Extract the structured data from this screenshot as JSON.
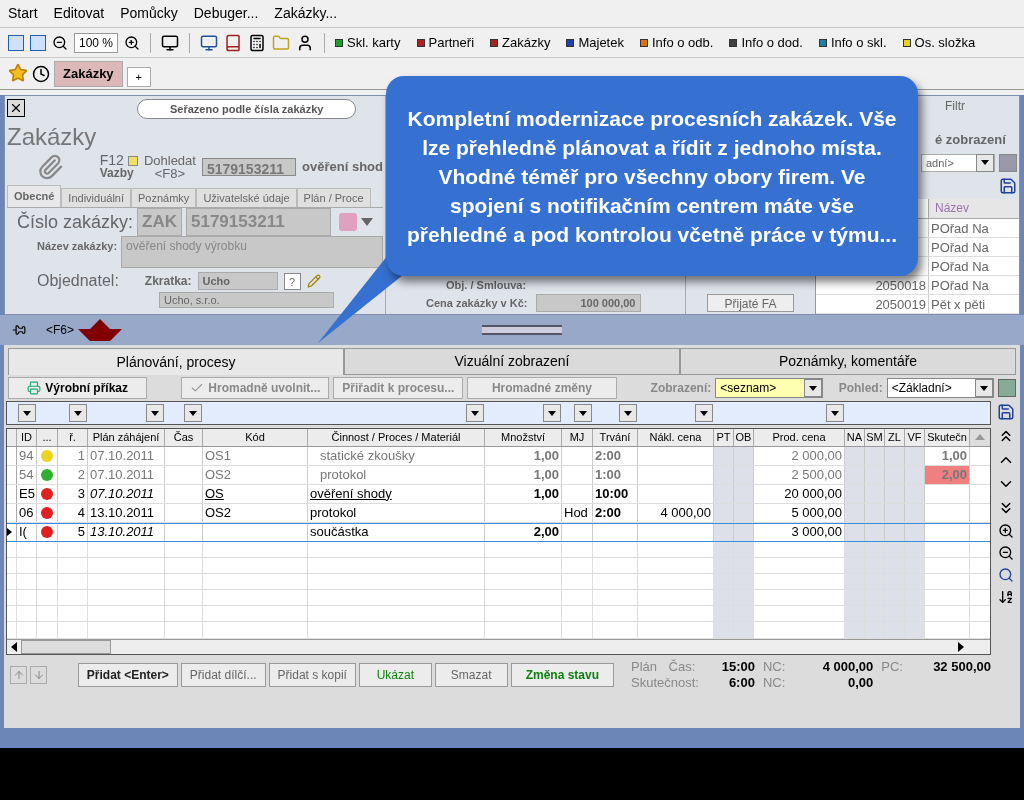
{
  "menu": [
    "Start",
    "Editovat",
    "Pomůcky",
    "Debuger...",
    "Zakázky..."
  ],
  "toolbar": {
    "zoom": "100 %",
    "shortcuts": [
      {
        "label": "Skl. karty",
        "color": "#1e9e2e"
      },
      {
        "label": "Partneři",
        "color": "#b02020"
      },
      {
        "label": "Zakázky",
        "color": "#b02020"
      },
      {
        "label": "Majetek",
        "color": "#2040c0"
      },
      {
        "label": "Info o odb.",
        "color": "#e07010"
      },
      {
        "label": "Info o dod.",
        "color": "#404040"
      },
      {
        "label": "Info o skl.",
        "color": "#2080a0"
      },
      {
        "label": "Os. složka",
        "color": "#e8d020"
      }
    ]
  },
  "doc_tabs": [
    {
      "label": "Zakázky",
      "selected": true
    }
  ],
  "new_tab": "+",
  "form": {
    "sort_hint": "Seřazeno podle čísla zakázky",
    "title": "Zakázky",
    "f12": "F12",
    "vazby": "Vazby",
    "search_label": "Dohledat",
    "search_key": "<F8>",
    "search_value": "5179153211",
    "search_result": "ověření shod",
    "tabs": [
      {
        "label": "Obecné",
        "selected": true
      },
      {
        "label": "Individuální",
        "selected": false
      },
      {
        "label": "Poznámky",
        "selected": false
      },
      {
        "label": "Uživatelské údaje",
        "selected": false
      },
      {
        "label": "Plán / Proce",
        "selected": false
      }
    ],
    "number_label": "Číslo zakázky:",
    "prefix": "ZAK",
    "number": "5179153211",
    "name_label": "Název zakázky:",
    "name": "ověření shody výrobku",
    "customer_label": "Objednatel:",
    "short_label": "Zkratka:",
    "short": "Ucho",
    "help": "?",
    "customer": "Ucho, s.r.o.",
    "contract_label": "Obj. / Smlouva:",
    "price_label": "Cena zakázky v Kč:",
    "price": "100 000,00",
    "invoice_button": "Přijaté FA",
    "filter": "Filtr",
    "view_partial": "é zobrazení",
    "view_select": "adní>",
    "list": {
      "header": "Název",
      "rows": [
        {
          "name": "POřad Na"
        },
        {
          "name": "POřad Na"
        },
        {
          "name": "POřad Na"
        },
        {
          "number": "2050018",
          "name": "POřad Na"
        },
        {
          "number": "2050019",
          "name": "Pět x pěti"
        }
      ]
    }
  },
  "callout": "Kompletní modernizace procesních zakázek. Vše lze přehledně plánovat a řídit z jednoho místa. Vhodné téměř pro všechny obory firem. Ve spojení s notifikačním centrem máte vše přehledné a pod kontrolou včetně práce v týmu...",
  "strip": {
    "key": "<F6>"
  },
  "lower": {
    "tabs": [
      {
        "label": "Plánování, procesy",
        "selected": true
      },
      {
        "label": "Vizuální zobrazení",
        "selected": false
      },
      {
        "label": "Poznámky, komentáře",
        "selected": false
      }
    ],
    "buttons": [
      {
        "label": "Výrobní příkaz",
        "disabled": false
      },
      {
        "label": "Hromadně uvolnit...",
        "disabled": true
      },
      {
        "label": "Přiřadit k procesu...",
        "disabled": true
      },
      {
        "label": "Hromadné změny",
        "disabled": true
      }
    ],
    "view_label": "Zobrazení:",
    "view": "<seznam>",
    "perspective_label": "Pohled:",
    "perspective": "<Základní>",
    "columns": [
      "ID",
      "...",
      "ř.",
      "Plán záhájení",
      "Čas",
      "Kód",
      "Činnost / Proces / Materiál",
      "Množství",
      "MJ",
      "Trvání",
      "Nákl. cena",
      "PT",
      "OB",
      "Prod. cena",
      "NA",
      "SM",
      "ZL",
      "VF",
      "Skutečn"
    ],
    "rows": [
      {
        "id": "94",
        "color": "#f0d020",
        "r": "1",
        "date": "07.10.2011",
        "code": "OS1",
        "activity": "statické zkoušky",
        "qty": "1,00",
        "duration": "2:00",
        "price": "2 000,00",
        "actual": "1,00",
        "muted": true,
        "italic_date": false,
        "underlined": false,
        "alert": false,
        "selected": false
      },
      {
        "id": "54",
        "color": "#30b030",
        "r": "2",
        "date": "07.10.2011",
        "code": "OS2",
        "activity": "protokol",
        "qty": "1,00",
        "duration": "1:00",
        "price": "2 500,00",
        "actual": "2,00",
        "muted": true,
        "italic_date": false,
        "underlined": false,
        "alert": true,
        "selected": false
      },
      {
        "id": "E5",
        "color": "#e02020",
        "r": "3",
        "date": "07.10.2011",
        "code": "OS",
        "activity": "ověření shody",
        "qty": "1,00",
        "duration": "10:00",
        "price": "20 000,00",
        "muted": false,
        "italic_date": true,
        "underlined": true,
        "alert": false,
        "selected": false
      },
      {
        "id": "06",
        "color": "#e02020",
        "r": "4",
        "date": "13.10.2011",
        "code": "OS2",
        "activity": "protokol",
        "unit": "Hod",
        "duration": "2:00",
        "cost": "4 000,00",
        "price": "5 000,00",
        "muted": false,
        "italic_date": false,
        "underlined": false,
        "alert": false,
        "selected": false
      },
      {
        "id": "I(",
        "color": "#e02020",
        "r": "5",
        "date": "13.10.2011",
        "activity": "součástka",
        "qty": "2,00",
        "price": "3 000,00",
        "muted": false,
        "italic_date": true,
        "underlined": false,
        "alert": false,
        "selected": true
      }
    ],
    "actions": [
      {
        "label": "Přidat <Enter>",
        "kind": "bold"
      },
      {
        "label": "Přidat dílčí...",
        "kind": "muted"
      },
      {
        "label": "Přidat s kopií",
        "kind": "muted"
      },
      {
        "label": "Ukázat",
        "kind": "green"
      },
      {
        "label": "Smazat",
        "kind": "muted"
      },
      {
        "label": "Změna stavu",
        "kind": "greenbold"
      }
    ],
    "totals": {
      "plan": "Plán",
      "time_label": "Čas:",
      "plan_time": "15:00",
      "nc_label": "NC:",
      "plan_nc": "4 000,00",
      "pc_label": "PC:",
      "plan_pc": "32 500,00",
      "actual": "Skutečnost:",
      "actual_time": "6:00",
      "actual_nc_label": "NC:",
      "actual_nc": "0,00"
    }
  }
}
